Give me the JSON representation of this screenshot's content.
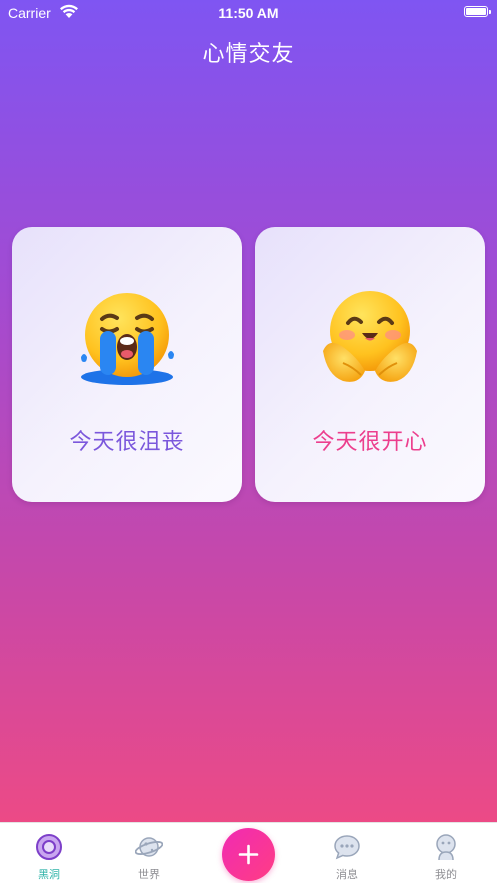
{
  "status_bar": {
    "carrier": "Carrier",
    "time": "11:50 AM"
  },
  "header": {
    "title": "心情交友"
  },
  "moods": [
    {
      "label": "今天很沮丧",
      "icon": "crying-face-icon"
    },
    {
      "label": "今天很开心",
      "icon": "hugging-face-icon"
    }
  ],
  "tabs": [
    {
      "label": "黑洞",
      "icon": "black-hole-icon",
      "active": true
    },
    {
      "label": "世界",
      "icon": "planet-icon",
      "active": false
    },
    {
      "label": "消息",
      "icon": "chat-bubble-icon",
      "active": false
    },
    {
      "label": "我的",
      "icon": "profile-icon",
      "active": false
    }
  ],
  "colors": {
    "gradient_top": "#7f55f2",
    "gradient_bottom": "#ec4a86",
    "sad_label": "#7b57dc",
    "happy_label": "#ec3e8d",
    "active_tab": "#2fb3a8",
    "add_button": "#f02bb3"
  }
}
